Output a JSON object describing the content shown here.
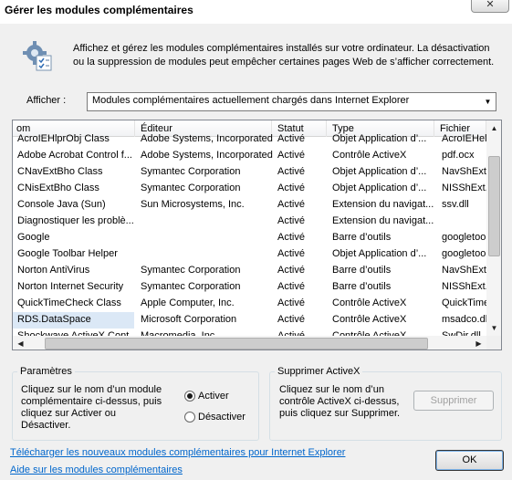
{
  "window": {
    "title": "Gérer les modules complémentaires",
    "close_glyph": "✕"
  },
  "header": {
    "description": "Affichez et gérez les modules complémentaires installés sur votre ordinateur. La désactivation ou la suppression de modules peut empêcher certaines pages Web de s’afficher correctement."
  },
  "filter": {
    "label": "Afficher :",
    "selected": "Modules complémentaires actuellement chargés dans Internet Explorer",
    "arrow_glyph": "▼"
  },
  "table": {
    "columns": [
      "om",
      "Éditeur",
      "Statut",
      "Type",
      "Fichier"
    ],
    "rows": [
      {
        "name": "AcroIEHlprObj Class",
        "publisher": "Adobe Systems, Incorporated",
        "status": "Activé",
        "type": "Objet Application d’...",
        "file": "AcroIEHelp"
      },
      {
        "name": "Adobe Acrobat Control f...",
        "publisher": "Adobe Systems, Incorporated",
        "status": "Activé",
        "type": "Contrôle ActiveX",
        "file": "pdf.ocx"
      },
      {
        "name": "CNavExtBho Class",
        "publisher": "Symantec Corporation",
        "status": "Activé",
        "type": "Objet Application d’...",
        "file": "NavShExt."
      },
      {
        "name": "CNisExtBho Class",
        "publisher": "Symantec Corporation",
        "status": "Activé",
        "type": "Objet Application d’...",
        "file": "NISShExt.d"
      },
      {
        "name": "Console Java (Sun)",
        "publisher": "Sun Microsystems, Inc.",
        "status": "Activé",
        "type": "Extension du navigat...",
        "file": "ssv.dll"
      },
      {
        "name": "Diagnostiquer les problè...",
        "publisher": "",
        "status": "Activé",
        "type": "Extension du navigat...",
        "file": ""
      },
      {
        "name": "Google",
        "publisher": "",
        "status": "Activé",
        "type": "Barre d’outils",
        "file": "googletoo"
      },
      {
        "name": "Google Toolbar Helper",
        "publisher": "",
        "status": "Activé",
        "type": "Objet Application d’...",
        "file": "googletoo"
      },
      {
        "name": "Norton AntiVirus",
        "publisher": "Symantec Corporation",
        "status": "Activé",
        "type": "Barre d’outils",
        "file": "NavShExt.c"
      },
      {
        "name": "Norton Internet Security",
        "publisher": "Symantec Corporation",
        "status": "Activé",
        "type": "Barre d’outils",
        "file": "NISShExt.d"
      },
      {
        "name": "QuickTimeCheck Class",
        "publisher": "Apple Computer, Inc.",
        "status": "Activé",
        "type": "Contrôle ActiveX",
        "file": "QuickTime"
      },
      {
        "name": "RDS.DataSpace",
        "publisher": "Microsoft Corporation",
        "status": "Activé",
        "type": "Contrôle ActiveX",
        "file": "msadco.dll"
      },
      {
        "name": "Shockwave ActiveX Cont...",
        "publisher": "Macromedia, Inc.",
        "status": "Activé",
        "type": "Contrôle ActiveX",
        "file": "SwDir.dll"
      }
    ],
    "scroll_glyphs": {
      "up": "▲",
      "down": "▼",
      "left": "◀",
      "right": "▶"
    }
  },
  "settings": {
    "legend": "Paramètres",
    "text": "Cliquez sur le nom d’un module complémentaire ci-dessus, puis cliquez sur Activer ou Désactiver.",
    "activate_label": "Activer",
    "deactivate_label": "Désactiver"
  },
  "activex": {
    "legend": "Supprimer ActiveX",
    "text": "Cliquez sur le nom d’un contrôle ActiveX ci-dessus, puis cliquez sur Supprimer.",
    "delete_label": "Supprimer"
  },
  "footer": {
    "download_link": "Télécharger les nouveaux modules complémentaires pour Internet Explorer",
    "help_link": "Aide sur les modules complémentaires",
    "ok_label": "OK"
  }
}
